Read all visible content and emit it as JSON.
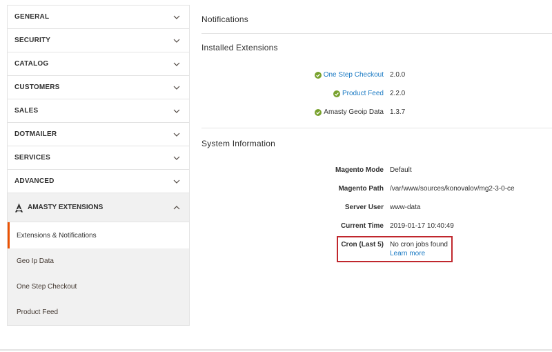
{
  "sidebar": {
    "items": [
      {
        "label": "GENERAL"
      },
      {
        "label": "SECURITY"
      },
      {
        "label": "CATALOG"
      },
      {
        "label": "CUSTOMERS"
      },
      {
        "label": "SALES"
      },
      {
        "label": "DOTMAILER"
      },
      {
        "label": "SERVICES"
      },
      {
        "label": "ADVANCED"
      }
    ],
    "expanded_section": {
      "label": "AMASTY EXTENSIONS",
      "icon": "amasty-logo-icon",
      "sub_items": [
        {
          "label": "Extensions & Notifications",
          "active": true
        },
        {
          "label": "Geo Ip Data"
        },
        {
          "label": "One Step Checkout"
        },
        {
          "label": "Product Feed"
        }
      ]
    }
  },
  "main": {
    "notifications_title": "Notifications",
    "installed_title": "Installed Extensions",
    "extensions": [
      {
        "name": "One Step Checkout",
        "version": "2.0.0",
        "link": true
      },
      {
        "name": "Product Feed",
        "version": "2.2.0",
        "link": true
      },
      {
        "name": "Amasty Geoip Data",
        "version": "1.3.7",
        "link": false
      }
    ],
    "system_title": "System Information",
    "system_info": [
      {
        "key": "Magento Mode",
        "value": "Default"
      },
      {
        "key": "Magento Path",
        "value": "/var/www/sources/konovalov/mg2-3-0-ce"
      },
      {
        "key": "Server User",
        "value": "www-data"
      },
      {
        "key": "Current Time",
        "value": "2019-01-17 10:40:49"
      },
      {
        "key": "Cron (Last 5)",
        "value": "No cron jobs found",
        "link": "Learn more"
      }
    ]
  },
  "colors": {
    "accent": "#eb5202",
    "link": "#1979c3",
    "check_green": "#79a22e",
    "highlight": "#c0272d"
  }
}
